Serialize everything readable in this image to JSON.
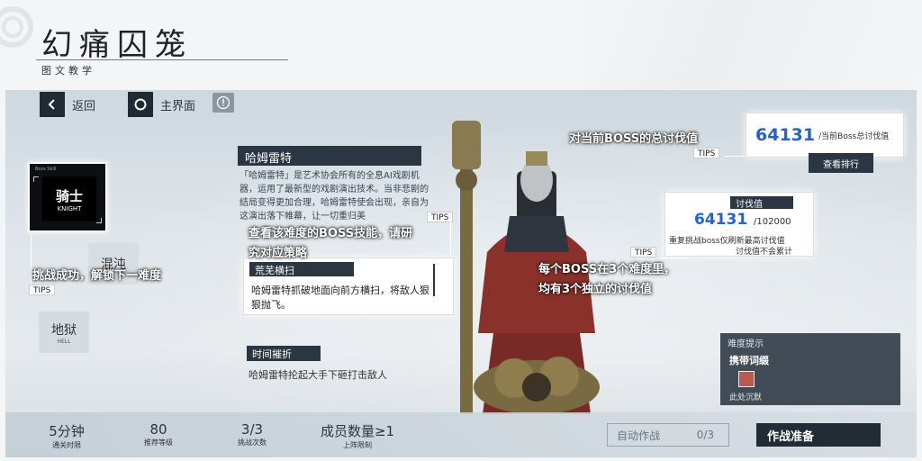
{
  "header": {
    "title": "幻痛囚笼",
    "subtitle": "图文教学"
  },
  "nav": {
    "back": "返回",
    "main": "主界面",
    "info_icon": "exclaim-icon"
  },
  "difficulties": [
    {
      "cn": "骑士",
      "en": "KNIGHT",
      "tag": "Boss Skill"
    },
    {
      "cn": "混沌",
      "en": ""
    },
    {
      "cn": "地狱",
      "en": "HELL"
    }
  ],
  "boss": {
    "name": "哈姆雷特",
    "desc": "「哈姆雷特」是艺术协会所有的全息AI戏剧机器，运用了最新型的戏剧演出技术。当非悲剧的结局变得更加合理，哈姆雷特使会出现，亲自为这演出落下帷幕，让一切重归美"
  },
  "skill": {
    "title": "荒芜横扫",
    "text": "哈姆雷特抓破地面向前方横扫，将敌人狠狠抛飞。"
  },
  "skill2": {
    "title": "时间摧折",
    "text": "哈姆雷特抡起大手下砸打击敌人"
  },
  "total": {
    "value": "64131",
    "label": "/当前Boss总讨伐值",
    "rank_button": "查看排行"
  },
  "score": {
    "title": "讨伐值",
    "value": "64131",
    "max": "/102000",
    "note1": "重复挑战boss仅刷新最高讨伐值",
    "note2": "讨伐值不会累计"
  },
  "hint": {
    "head": "难度提示",
    "item": "携带词缀",
    "sub": "此处沉默"
  },
  "stats": [
    {
      "value": "5分钟",
      "label": "通关时限"
    },
    {
      "value": "80",
      "label": "推荐等级"
    },
    {
      "value": "3/3",
      "label": "挑战次数"
    },
    {
      "value": "成员数量≥1",
      "label": "上阵限制"
    }
  ],
  "auto": {
    "label": "自动作战",
    "count": "0/3"
  },
  "start_button": "作战准备",
  "annotations": {
    "total": "对当前BOSS的总讨伐值",
    "skill": "查看该难度的BOSS技能，请研",
    "skill2": "究对应策略",
    "unlock": "挑战成功，解锁下一难度",
    "score1": "每个BOSS在3个难度里，",
    "score2": "均有3个独立的讨伐值",
    "tips": "TIPS"
  }
}
